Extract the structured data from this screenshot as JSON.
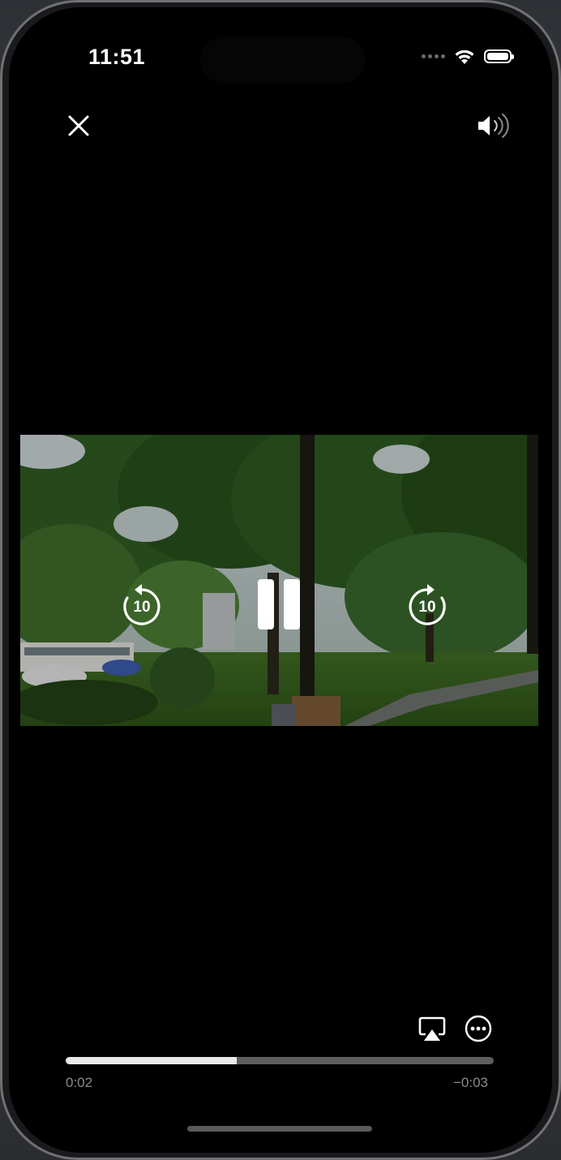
{
  "status_bar": {
    "time": "11:51",
    "icons": [
      "cellular-signal-icon",
      "wifi-icon",
      "battery-icon"
    ]
  },
  "top_controls": {
    "close_icon": "close-icon",
    "volume_icon": "speaker-volume-icon"
  },
  "video": {
    "skip_back": {
      "icon": "rewind-10-icon",
      "label": "10"
    },
    "play_pause": {
      "icon": "pause-icon"
    },
    "skip_forward": {
      "icon": "forward-10-icon",
      "label": "10"
    }
  },
  "bottom_controls": {
    "airplay_icon": "airplay-icon",
    "more_icon": "more-options-icon",
    "progress_fraction": 0.4,
    "elapsed": "0:02",
    "remaining": "−0:03"
  },
  "colors": {
    "background": "#000000",
    "foreground": "#ffffff",
    "track": "#5e5e60",
    "track_fill": "#e9e9e9",
    "time_text": "#8b8b8d"
  }
}
